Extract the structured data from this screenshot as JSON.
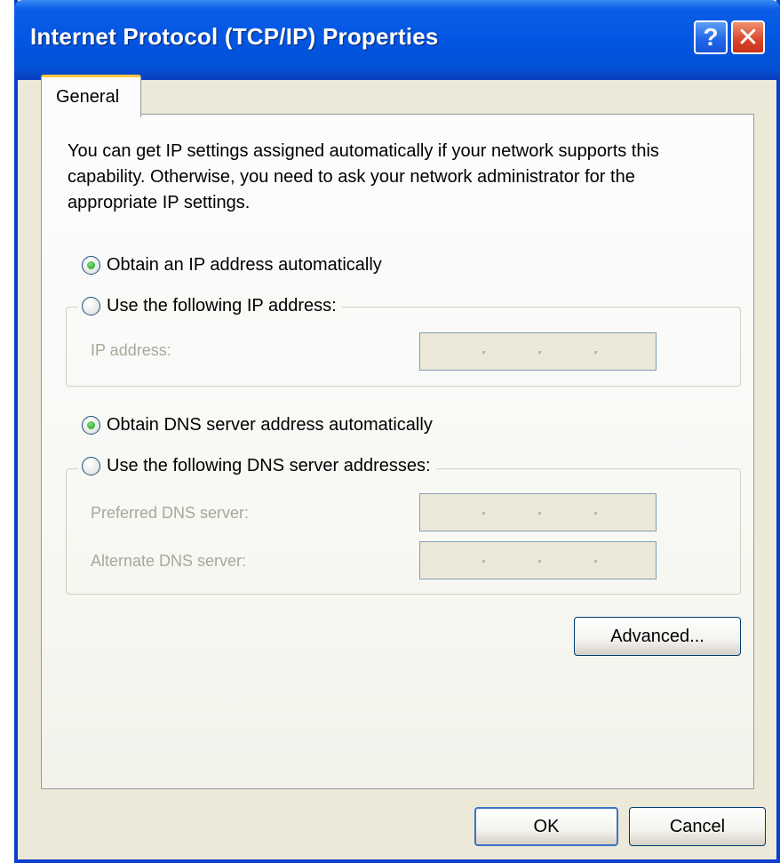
{
  "window": {
    "title": "Internet Protocol (TCP/IP) Properties",
    "help_symbol": "?",
    "close_symbol": "✕"
  },
  "tabs": [
    {
      "label": "General",
      "selected": true
    }
  ],
  "intro_text": "You can get IP settings assigned automatically if your network supports this capability. Otherwise, you need to ask your network administrator for the appropriate IP settings.",
  "ip_section": {
    "auto_option": {
      "label": "Obtain an IP address automatically",
      "checked": true
    },
    "manual_option": {
      "label": "Use the following IP address:",
      "checked": false
    },
    "ip_address_label": "IP address:",
    "ip_address_value": ""
  },
  "dns_section": {
    "auto_option": {
      "label": "Obtain DNS server address automatically",
      "checked": true
    },
    "manual_option": {
      "label": "Use the following DNS server addresses:",
      "checked": false
    },
    "preferred_label": "Preferred DNS server:",
    "preferred_value": "",
    "alternate_label": "Alternate DNS server:",
    "alternate_value": ""
  },
  "buttons": {
    "advanced": "Advanced...",
    "ok": "OK",
    "cancel": "Cancel"
  },
  "colors": {
    "titlebar": "#0256e2",
    "dialog_bg": "#ece9d8",
    "tab_highlight": "#ffc83c",
    "radio_checked": "#1e9a1a",
    "close_button": "#d8452a"
  },
  "icons": {
    "help": "help-icon",
    "close": "close-icon"
  }
}
